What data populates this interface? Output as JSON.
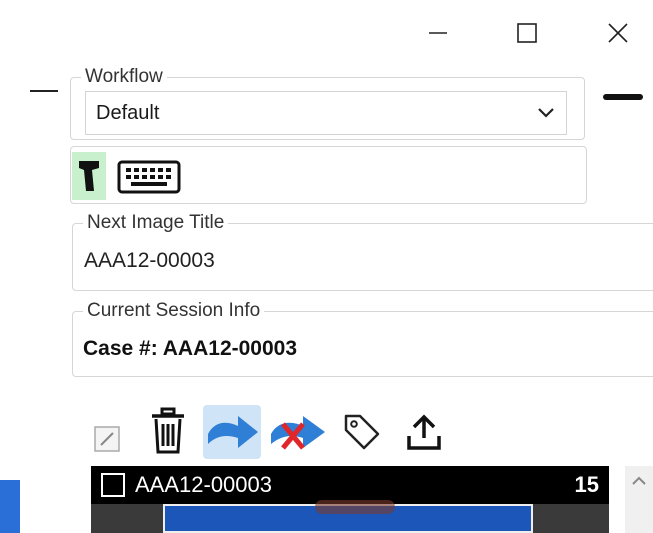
{
  "window": {
    "minimize_icon": "minimize-icon",
    "maximize_icon": "maximize-icon",
    "close_icon": "close-icon"
  },
  "workflow": {
    "legend": "Workflow",
    "selected": "Default"
  },
  "input_mode": {
    "scanner_icon": "barcode-scanner-icon",
    "keyboard_icon": "keyboard-icon",
    "active_color": "#c8f0cc"
  },
  "next_image": {
    "legend": "Next Image Title",
    "value": "AAA12-00003"
  },
  "session": {
    "legend": "Current Session Info",
    "case_line": "Case #: AAA12-00003"
  },
  "toolbar": {
    "icons": [
      "edit-icon",
      "trash-icon",
      "send-arrow-icon",
      "cancel-send-icon",
      "tag-icon",
      "upload-icon"
    ],
    "accent": "#2f7fd6"
  },
  "image_strip": {
    "title": "AAA12-00003",
    "count": "15"
  }
}
